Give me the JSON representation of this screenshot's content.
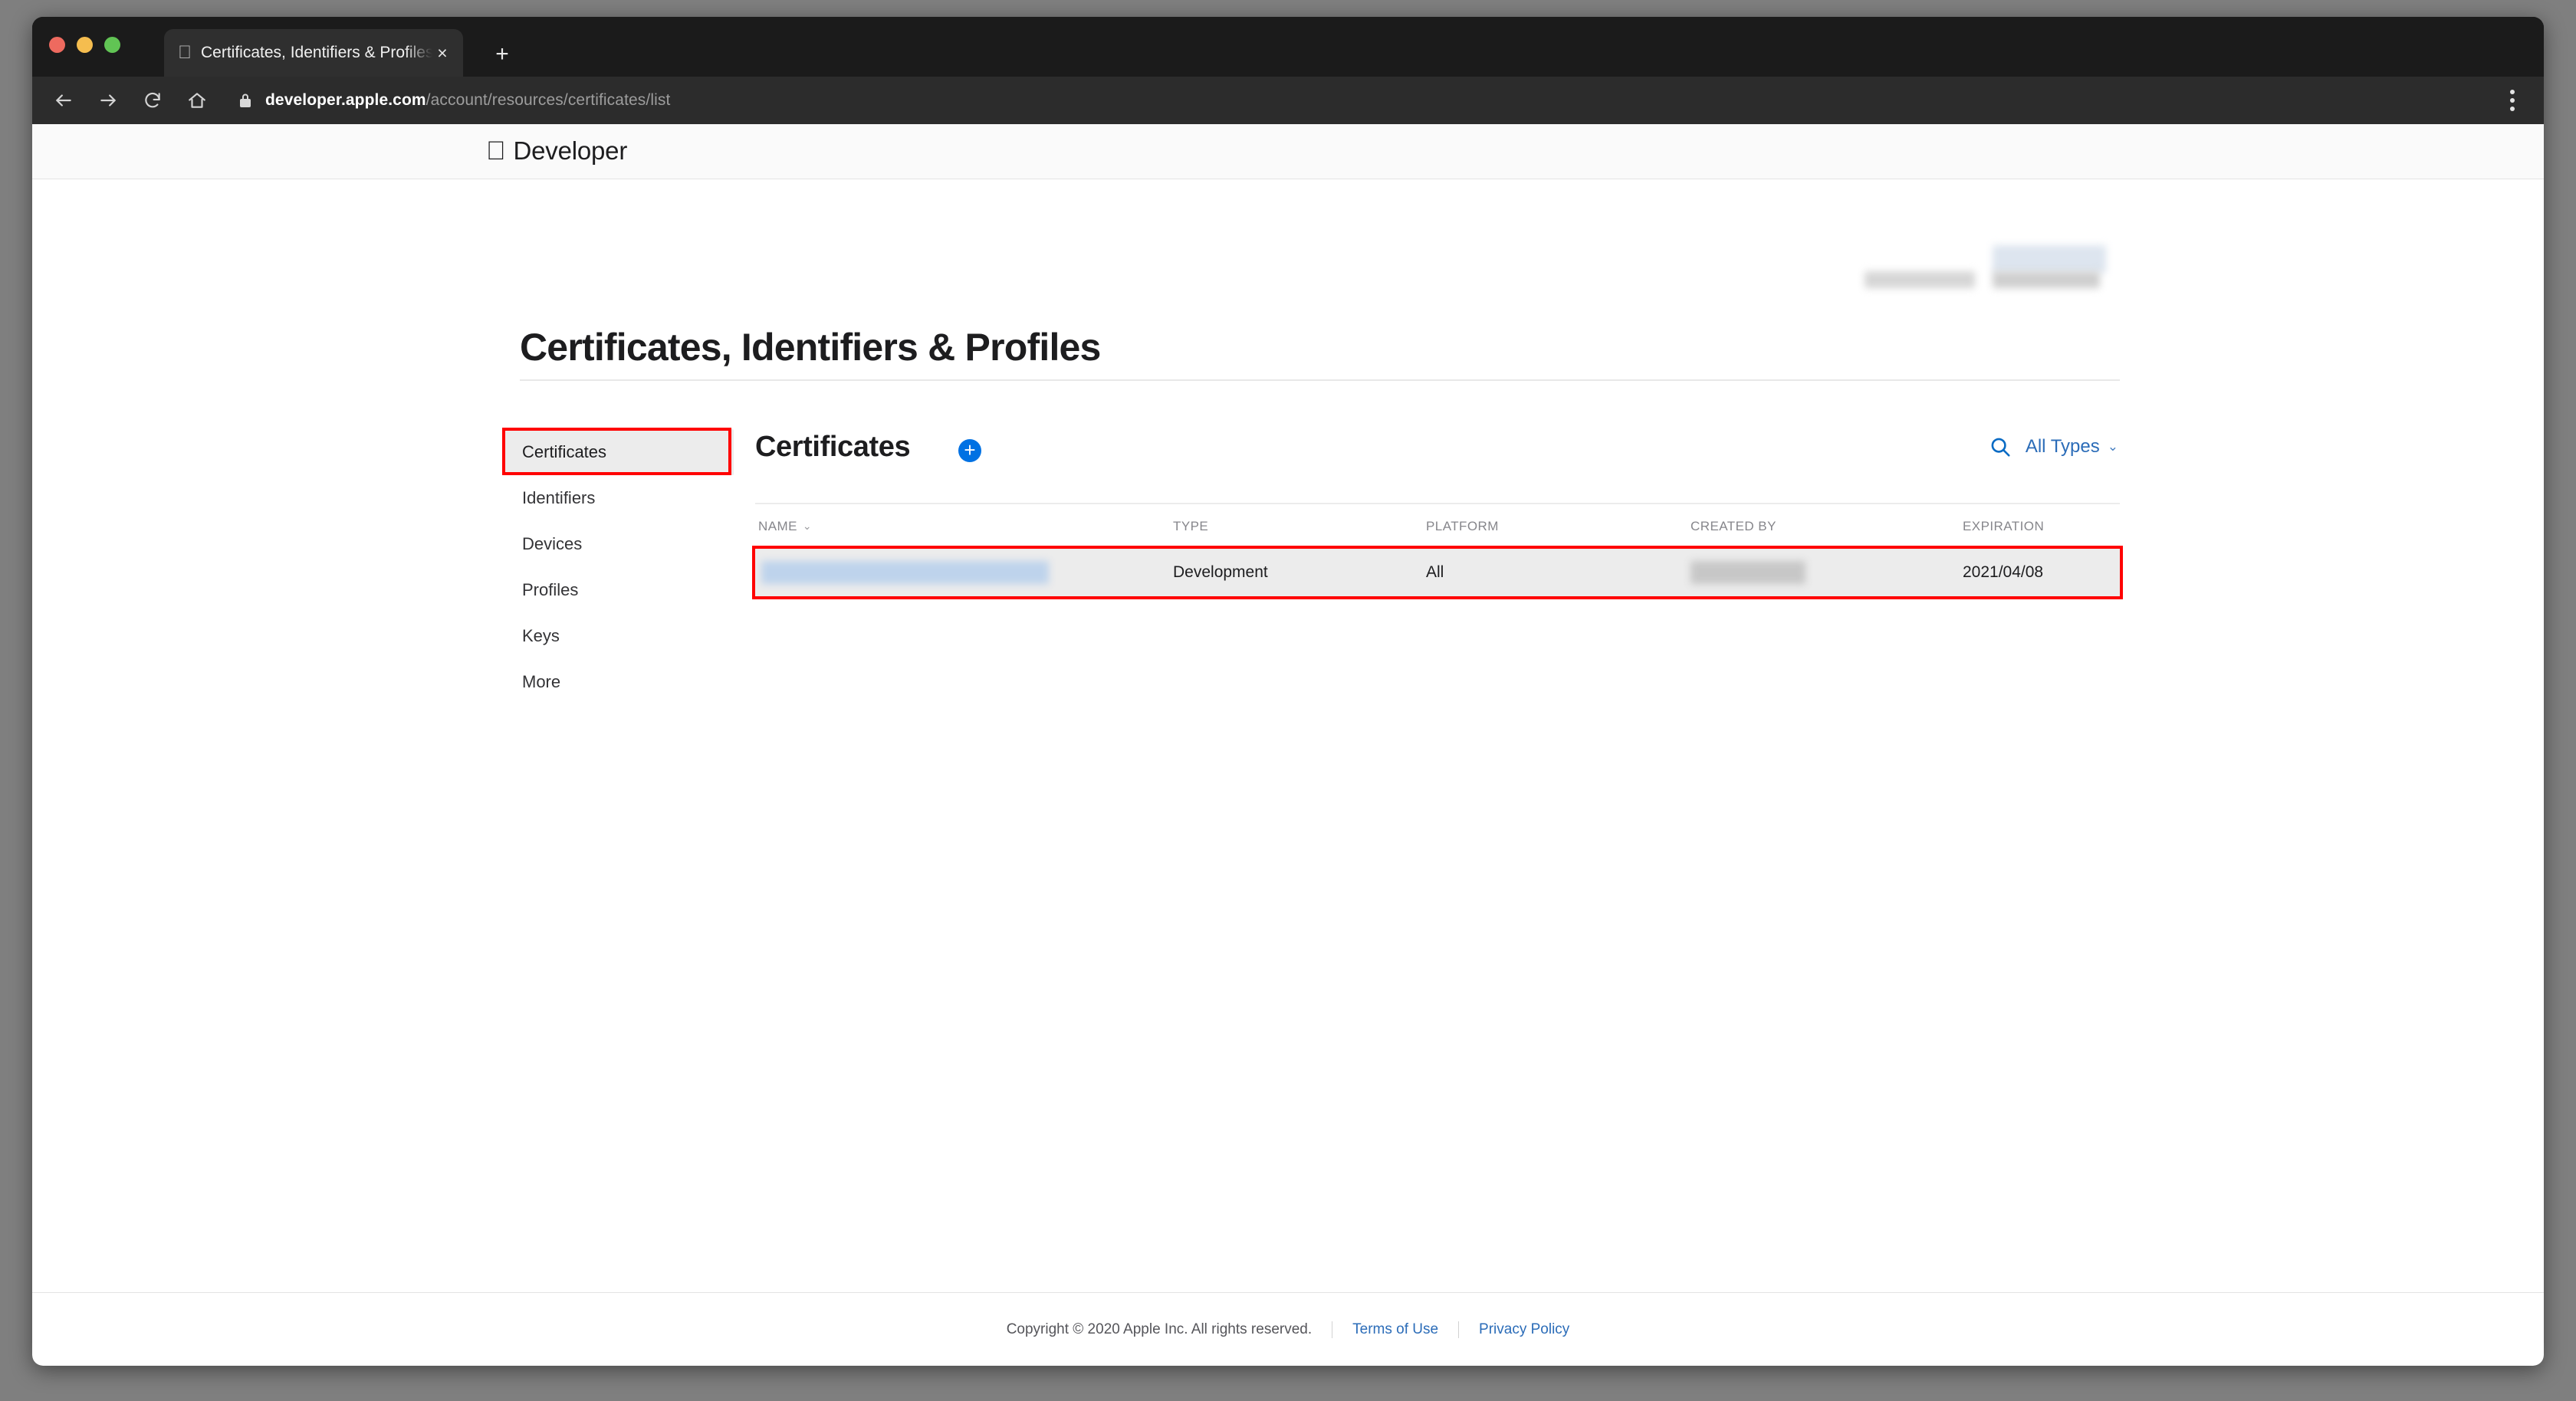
{
  "browser": {
    "traffic_lights": [
      "close",
      "minimize",
      "maximize"
    ],
    "tab": {
      "favicon": "apple-icon",
      "title": "Certificates, Identifiers & Profiles",
      "close_label": "×"
    },
    "new_tab_label": "+",
    "toolbar": {
      "back_icon": "back-arrow-icon",
      "forward_icon": "forward-arrow-icon",
      "reload_icon": "reload-icon",
      "home_icon": "home-icon",
      "lock_icon": "lock-icon",
      "url_host": "developer.apple.com",
      "url_path": "/account/resources/certificates/list",
      "menu_icon": "three-dot-menu-icon"
    }
  },
  "site_header": {
    "apple_glyph": "",
    "wordmark": "Developer"
  },
  "page": {
    "title": "Certificates, Identifiers & Profiles"
  },
  "sidebar": {
    "items": [
      {
        "label": "Certificates",
        "selected": true
      },
      {
        "label": "Identifiers",
        "selected": false
      },
      {
        "label": "Devices",
        "selected": false
      },
      {
        "label": "Profiles",
        "selected": false
      },
      {
        "label": "Keys",
        "selected": false
      },
      {
        "label": "More",
        "selected": false
      }
    ]
  },
  "content": {
    "title": "Certificates",
    "add_button_label": "+",
    "search_icon": "search-icon",
    "type_filter": {
      "label": "All Types",
      "chevron": "⌄"
    },
    "table": {
      "columns": [
        {
          "key": "name",
          "label": "NAME",
          "sortable": true,
          "sort_chevron": "⌄"
        },
        {
          "key": "type",
          "label": "TYPE",
          "sortable": false
        },
        {
          "key": "platform",
          "label": "PLATFORM",
          "sortable": false
        },
        {
          "key": "created_by",
          "label": "CREATED BY",
          "sortable": false
        },
        {
          "key": "expiration",
          "label": "EXPIRATION",
          "sortable": false
        }
      ],
      "rows": [
        {
          "name": "",
          "name_redacted": true,
          "type": "Development",
          "platform": "All",
          "created_by": "",
          "created_by_redacted": true,
          "expiration": "2021/04/08",
          "highlighted": true
        }
      ]
    }
  },
  "footer": {
    "copyright": "Copyright © 2020 Apple Inc. All rights reserved.",
    "links": [
      {
        "label": "Terms of Use"
      },
      {
        "label": "Privacy Policy"
      }
    ]
  },
  "annotations": {
    "highlight_color": "#ff0000",
    "accent_blue": "#0071e3",
    "link_blue": "#2b6cb8"
  }
}
